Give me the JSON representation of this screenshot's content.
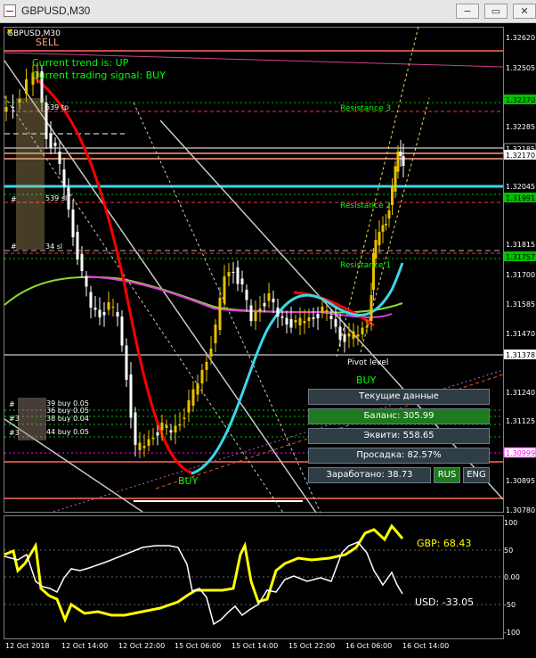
{
  "window": {
    "title": "GBPUSD,M30",
    "minimize": "−",
    "restore": "▭",
    "close": "✕"
  },
  "chart_header": {
    "symbol_label": "GBPUSD,M30",
    "sell_label": "SELL",
    "trend_text": "Current trend is: UP",
    "signal_text": "Current trading signal: BUY",
    "buy_top": "BUY",
    "buy_bottom": "BUY",
    "pivot_label": "Pivot level"
  },
  "resistance": {
    "r3": "Resistance 3",
    "r2": "Resistance 2",
    "r1": "Resistance 1"
  },
  "order_tags": {
    "tp": "539 tp",
    "sl": "539 sl",
    "sl2": "34 sl",
    "b1": "39 buy 0.05",
    "b2": "36 buy 0.05",
    "b3": "38 buy 0.04",
    "b4": "44 buy 0.05",
    "h1": "#",
    "h2": "#",
    "h3": "#",
    "h4": "#3",
    "h5": "#3"
  },
  "price_axis": {
    "ticks": [
      "1.32620",
      "1.32505",
      "1.32285",
      "1.32045",
      "1.31815",
      "1.31700",
      "1.31585",
      "1.31470",
      "1.31240",
      "1.31125",
      "1.30895",
      "1.30780"
    ],
    "badges": [
      {
        "value": "1.32370",
        "color": "#00c000"
      },
      {
        "value": "1.32185",
        "color": "#000000"
      },
      {
        "value": "1.32170",
        "color": "#000000"
      },
      {
        "value": "1.31991",
        "color": "#00c000"
      },
      {
        "value": "1.31757",
        "color": "#00c000"
      },
      {
        "value": "1.31378",
        "color": "#000000"
      },
      {
        "value": "1.30999",
        "color": "#ff00ff"
      }
    ]
  },
  "time_axis": {
    "labels": [
      "12 Oct 2018",
      "12 Oct 14:00",
      "12 Oct 22:00",
      "15 Oct 06:00",
      "15 Oct 14:00",
      "15 Oct 22:00",
      "16 Oct 06:00",
      "16 Oct 14:00"
    ]
  },
  "info_panel": {
    "header": "Текущие данные",
    "balance": "Баланс: 305.99",
    "equity": "Эквити: 558.65",
    "drawdown": "Просадка: 82.57%",
    "earned": "Заработано: 38.73",
    "rus": "RUS",
    "eng": "ENG"
  },
  "sub_chart": {
    "scale": [
      "100",
      "50",
      "0.00",
      "-50",
      "-100"
    ],
    "gbp_label": "GBP: 68.43",
    "usd_label": "USD: -33.05"
  },
  "colors": {
    "background": "#000000",
    "resistance": "#00ff00",
    "cyan": "#3ad8e8",
    "ma_red": "#ff0000",
    "ma_green": "#88d830",
    "ma_magenta": "#e040e0",
    "bull": "#e8c000",
    "bear": "#ffffff",
    "gbp_line": "#ffff00",
    "usd_line": "#ffffff"
  }
}
